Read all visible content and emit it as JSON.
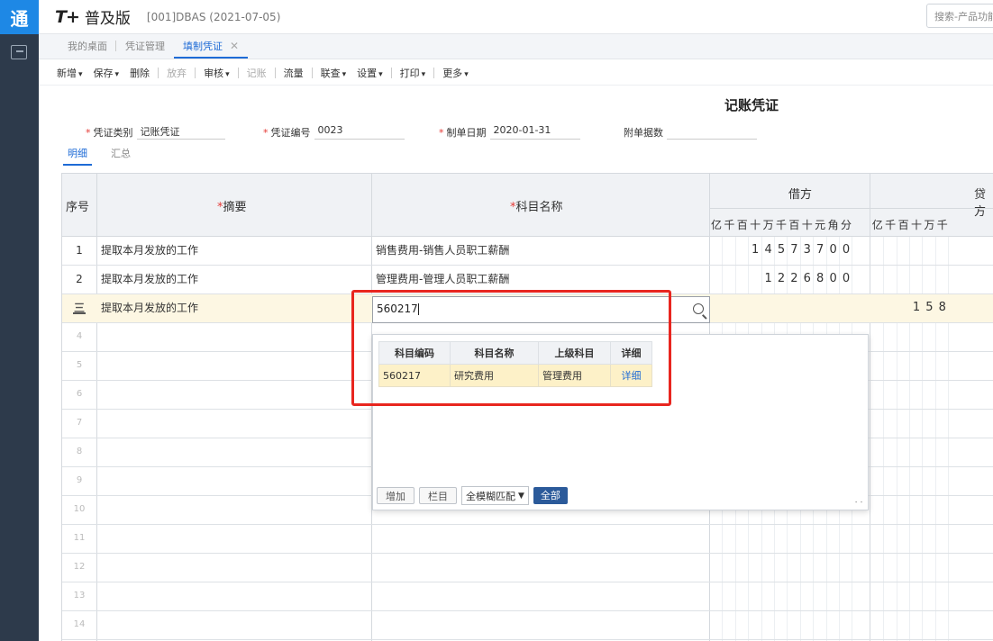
{
  "rail": {
    "logo": "通"
  },
  "header": {
    "brand_mark": "T+",
    "brand_name": "普及版",
    "company": "[001]DBAS   (2021-07-05)",
    "search_placeholder": "搜索-产品功能"
  },
  "tabs": [
    {
      "label": "我的桌面"
    },
    {
      "label": "凭证管理"
    },
    {
      "label": "填制凭证",
      "close": "✕"
    }
  ],
  "toolbar": [
    {
      "label": "新增",
      "caret": true
    },
    {
      "label": "保存",
      "caret": true
    },
    {
      "label": "删除"
    },
    {
      "label": "放弃",
      "disabled": true
    },
    {
      "label": "审核",
      "caret": true
    },
    {
      "label": "记账",
      "disabled": true
    },
    {
      "label": "流量"
    },
    {
      "label": "联查",
      "caret": true
    },
    {
      "label": "设置",
      "caret": true
    },
    {
      "label": "打印",
      "caret": true
    },
    {
      "label": "更多",
      "caret": true
    }
  ],
  "voucher": {
    "title": "记账凭证",
    "type_label": "凭证类别",
    "type_value": "记账凭证",
    "number_label": "凭证编号",
    "number_value": "0023",
    "date_label": "制单日期",
    "date_value": "2020-01-31",
    "attach_label": "附单据数",
    "attach_value": ""
  },
  "subtabs": [
    "明细",
    "汇总"
  ],
  "grid": {
    "col_seq": "序号",
    "col_summary": "摘要",
    "col_account": "科目名称",
    "col_debit": "借方",
    "col_credit": "贷方",
    "debit_digits": [
      "亿",
      "千",
      "百",
      "十",
      "万",
      "千",
      "百",
      "十",
      "元",
      "角",
      "分"
    ],
    "credit_digits": [
      "亿",
      "千",
      "百",
      "十",
      "万",
      "千"
    ],
    "rows": [
      {
        "seq": "1",
        "summary": "提取本月发放的工作",
        "account": "销售费用-销售人员职工薪酬",
        "debit": [
          "",
          "",
          "",
          "",
          "1",
          "4",
          "5",
          "7",
          "3",
          "7",
          "0",
          "0"
        ],
        "credit": []
      },
      {
        "seq": "2",
        "summary": "提取本月发放的工作",
        "account": "管理费用-管理人员职工薪酬",
        "debit": [
          "",
          "",
          "",
          "",
          "",
          "1",
          "2",
          "2",
          "6",
          "8",
          "0",
          "0"
        ],
        "credit": []
      },
      {
        "seq": "3",
        "summary": "提取本月发放的工作",
        "account": "",
        "debit": [],
        "credit": [
          "",
          "",
          "",
          "1",
          "5",
          "8"
        ]
      }
    ],
    "empty_rows": [
      "4",
      "5",
      "6",
      "7",
      "8",
      "9",
      "10",
      "11",
      "12",
      "13",
      "14"
    ]
  },
  "subject_input": {
    "value": "560217"
  },
  "dropdown": {
    "headers": [
      "科目编码",
      "科目名称",
      "上级科目",
      "详细"
    ],
    "rows": [
      {
        "code": "560217",
        "name": "研究费用",
        "parent": "管理费用",
        "detail": "详细"
      }
    ],
    "btn_add": "增加",
    "btn_column": "栏目",
    "match_mode": "全模糊匹配",
    "btn_all": "全部"
  }
}
